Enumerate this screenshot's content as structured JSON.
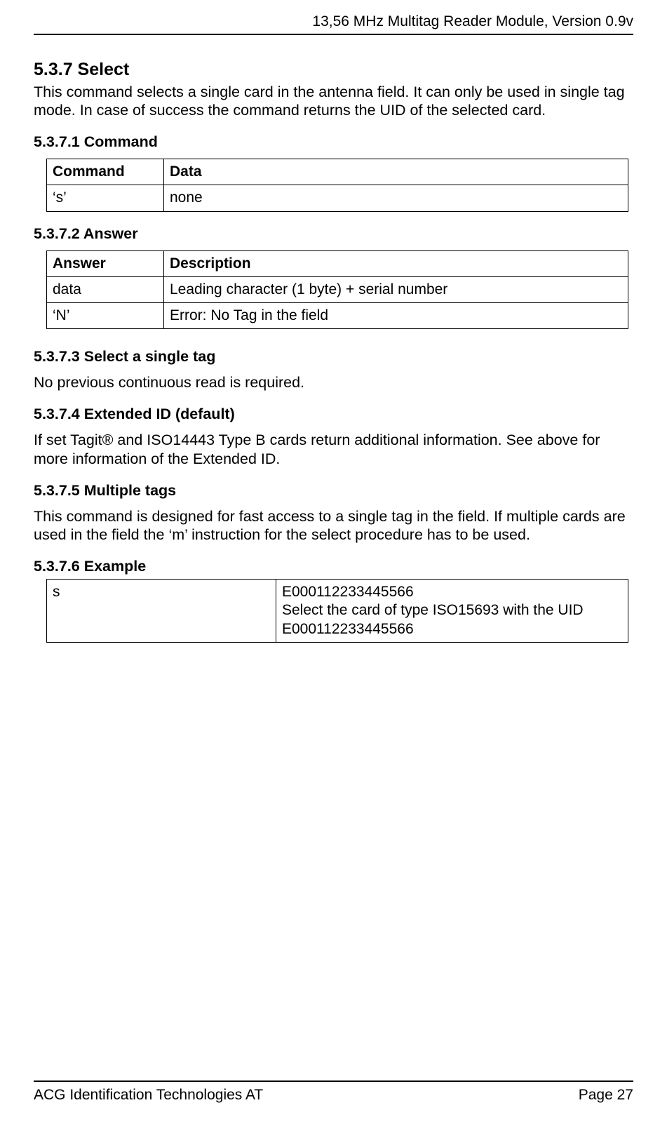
{
  "header": {
    "title": "13,56 MHz Multitag Reader Module, Version 0.9v"
  },
  "s537": {
    "heading": "5.3.7 Select",
    "intro": "This command selects a single card in the antenna field. It can only be used in single tag mode. In case of success the command returns the UID of the selected card.",
    "s1": {
      "heading": "5.3.7.1 Command",
      "th1": "Command",
      "th2": "Data",
      "r1c1": "‘s’",
      "r1c2": "none"
    },
    "s2": {
      "heading": "5.3.7.2 Answer",
      "th1": "Answer",
      "th2": "Description",
      "r1c1": "data",
      "r1c2": "Leading character (1 byte) + serial number",
      "r2c1": "‘N’",
      "r2c2": "Error: No Tag in the field"
    },
    "s3": {
      "heading": "5.3.7.3 Select a single tag",
      "body": "No previous continuous read is required."
    },
    "s4": {
      "heading": "5.3.7.4 Extended ID (default)",
      "body": "If set Tagit® and ISO14443 Type B cards return additional information. See above for more information of the Extended ID."
    },
    "s5": {
      "heading": "5.3.7.5 Multiple tags",
      "body": "This command is designed for fast access to a single tag in the field. If multiple cards are used in the field the ‘m’ instruction for the select procedure has to be used."
    },
    "s6": {
      "heading": "5.3.7.6 Example",
      "r1c1": "s",
      "r1c2_line1": "E000112233445566",
      "r1c2_line2": "Select the card of type ISO15693 with the UID E000112233445566"
    }
  },
  "footer": {
    "left": "ACG Identification Technologies AT",
    "right": "Page 27"
  }
}
